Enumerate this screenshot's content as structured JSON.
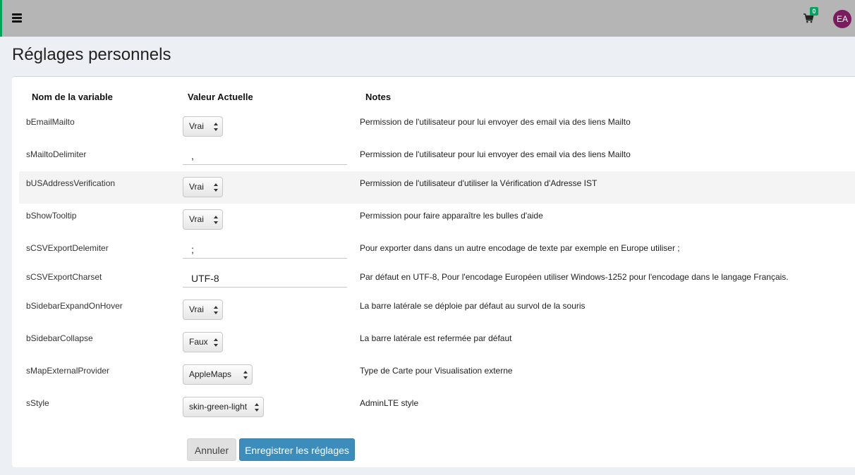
{
  "navbar": {
    "cart_count": "0",
    "avatar_initials": "EA"
  },
  "page_title": "Réglages personnels",
  "columns": {
    "name": "Nom de la variable",
    "value": "Valeur Actuelle",
    "notes": "Notes"
  },
  "settings": [
    {
      "name": "bEmailMailto",
      "type": "select",
      "value": "Vrai",
      "note": "Permission de l'utilisateur pour lui envoyer des email via des liens Mailto"
    },
    {
      "name": "sMailtoDelimiter",
      "type": "text",
      "value": ",",
      "note": "Permission de l'utilisateur pour lui envoyer des email via des liens Mailto"
    },
    {
      "name": "bUSAddressVerification",
      "type": "select",
      "value": "Vrai",
      "note": "Permission de l'utilisateur d'utiliser la Vérification d'Adresse IST"
    },
    {
      "name": "bShowTooltip",
      "type": "select",
      "value": "Vrai",
      "note": "Permission pour faire apparaître les bulles d'aide"
    },
    {
      "name": "sCSVExportDelemiter",
      "type": "text",
      "value": ";",
      "note": "Pour exporter dans dans un autre encodage de texte par exemple en Europe utiliser ;"
    },
    {
      "name": "sCSVExportCharset",
      "type": "text",
      "value": "UTF-8",
      "note": "Par défaut en UTF-8, Pour l'encodage Européen utiliser Windows-1252 pour l'encodage dans le langage Français."
    },
    {
      "name": "bSidebarExpandOnHover",
      "type": "select",
      "value": "Vrai",
      "note": "La barre latérale se déploie par défaut au survol de la souris"
    },
    {
      "name": "bSidebarCollapse",
      "type": "select",
      "value": "Faux",
      "note": "La barre latérale est refermée par défaut"
    },
    {
      "name": "sMapExternalProvider",
      "type": "select",
      "value": "AppleMaps",
      "note": "Type de Carte pour Visualisation externe"
    },
    {
      "name": "sStyle",
      "type": "select",
      "value": "skin-green-light",
      "note": "AdminLTE style"
    }
  ],
  "buttons": {
    "cancel": "Annuler",
    "save": "Enregistrer les réglages"
  },
  "colors": {
    "accent": "#00a65a",
    "primary_button": "#3c8dbc",
    "avatar": "#7a1c5e",
    "navbar": "#b5b5b5"
  }
}
